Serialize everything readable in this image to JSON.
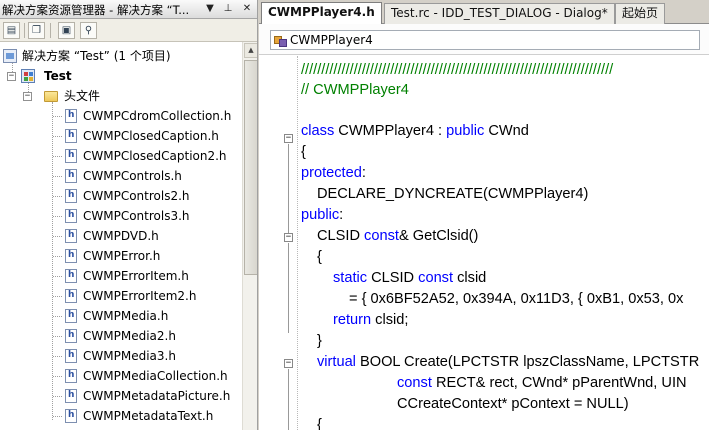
{
  "solution_explorer": {
    "title": "解决方案资源管理器 - 解决方案 “T...",
    "pin_icon": "pin-icon",
    "close_icon": "close-icon",
    "dropdown_icon": "dropdown-arrow-icon",
    "solution_label": "解决方案 “Test” (1 个项目)",
    "project_label": "Test",
    "folder_label": "头文件",
    "files": [
      "CWMPCdromCollection.h",
      "CWMPClosedCaption.h",
      "CWMPClosedCaption2.h",
      "CWMPControls.h",
      "CWMPControls2.h",
      "CWMPControls3.h",
      "CWMPDVD.h",
      "CWMPError.h",
      "CWMPErrorItem.h",
      "CWMPErrorItem2.h",
      "CWMPMedia.h",
      "CWMPMedia2.h",
      "CWMPMedia3.h",
      "CWMPMediaCollection.h",
      "CWMPMetadataPicture.h",
      "CWMPMetadataText.h"
    ],
    "toolbar_icons": [
      "properties-icon",
      "show-all-files-icon",
      "refresh-icon",
      "view-class-diagram-icon"
    ]
  },
  "editor": {
    "tabs": [
      {
        "label": "CWMPPlayer4.h",
        "active": true
      },
      {
        "label": "Test.rc - IDD_TEST_DIALOG - Dialog*",
        "active": false
      },
      {
        "label": "起始页",
        "active": false
      }
    ],
    "nav_class": "CWMPPlayer4",
    "code": {
      "l1": "/////////////////////////////////////////////////////////////////////////////",
      "l2": "// CWMPPlayer4",
      "l4_kw": "class",
      "l4_a": " CWMPPlayer4 : ",
      "l4_kw2": "public",
      "l4_b": " CWnd",
      "l5": "{",
      "l6_kw": "protected",
      "l6_b": ":",
      "l7": "DECLARE_DYNCREATE(CWMPPlayer4)",
      "l8_kw": "public",
      "l8_b": ":",
      "l9_a": "CLSID ",
      "l9_kw": "const",
      "l9_b": "& GetClsid()",
      "l10": "{",
      "l11_kw": "static",
      "l11_a": " CLSID ",
      "l11_kw2": "const",
      "l11_b": " clsid",
      "l12": "= { 0x6BF52A52, 0x394A, 0x11D3, { 0xB1, 0x53, 0x",
      "l13_kw": "return",
      "l13_b": " clsid;",
      "l14": "}",
      "l15_kw": "virtual",
      "l15_b": " BOOL Create(LPCTSTR lpszClassName, LPCTSTR",
      "l16_kw": "const",
      "l16_b": " RECT& rect, CWnd* pParentWnd, UIN",
      "l17": "CCreateContext* pContext = NULL)",
      "l18": "{"
    }
  },
  "colors": {
    "keyword": "#0000ff",
    "comment": "#008000",
    "panel_bg": "#d4d0c8"
  }
}
